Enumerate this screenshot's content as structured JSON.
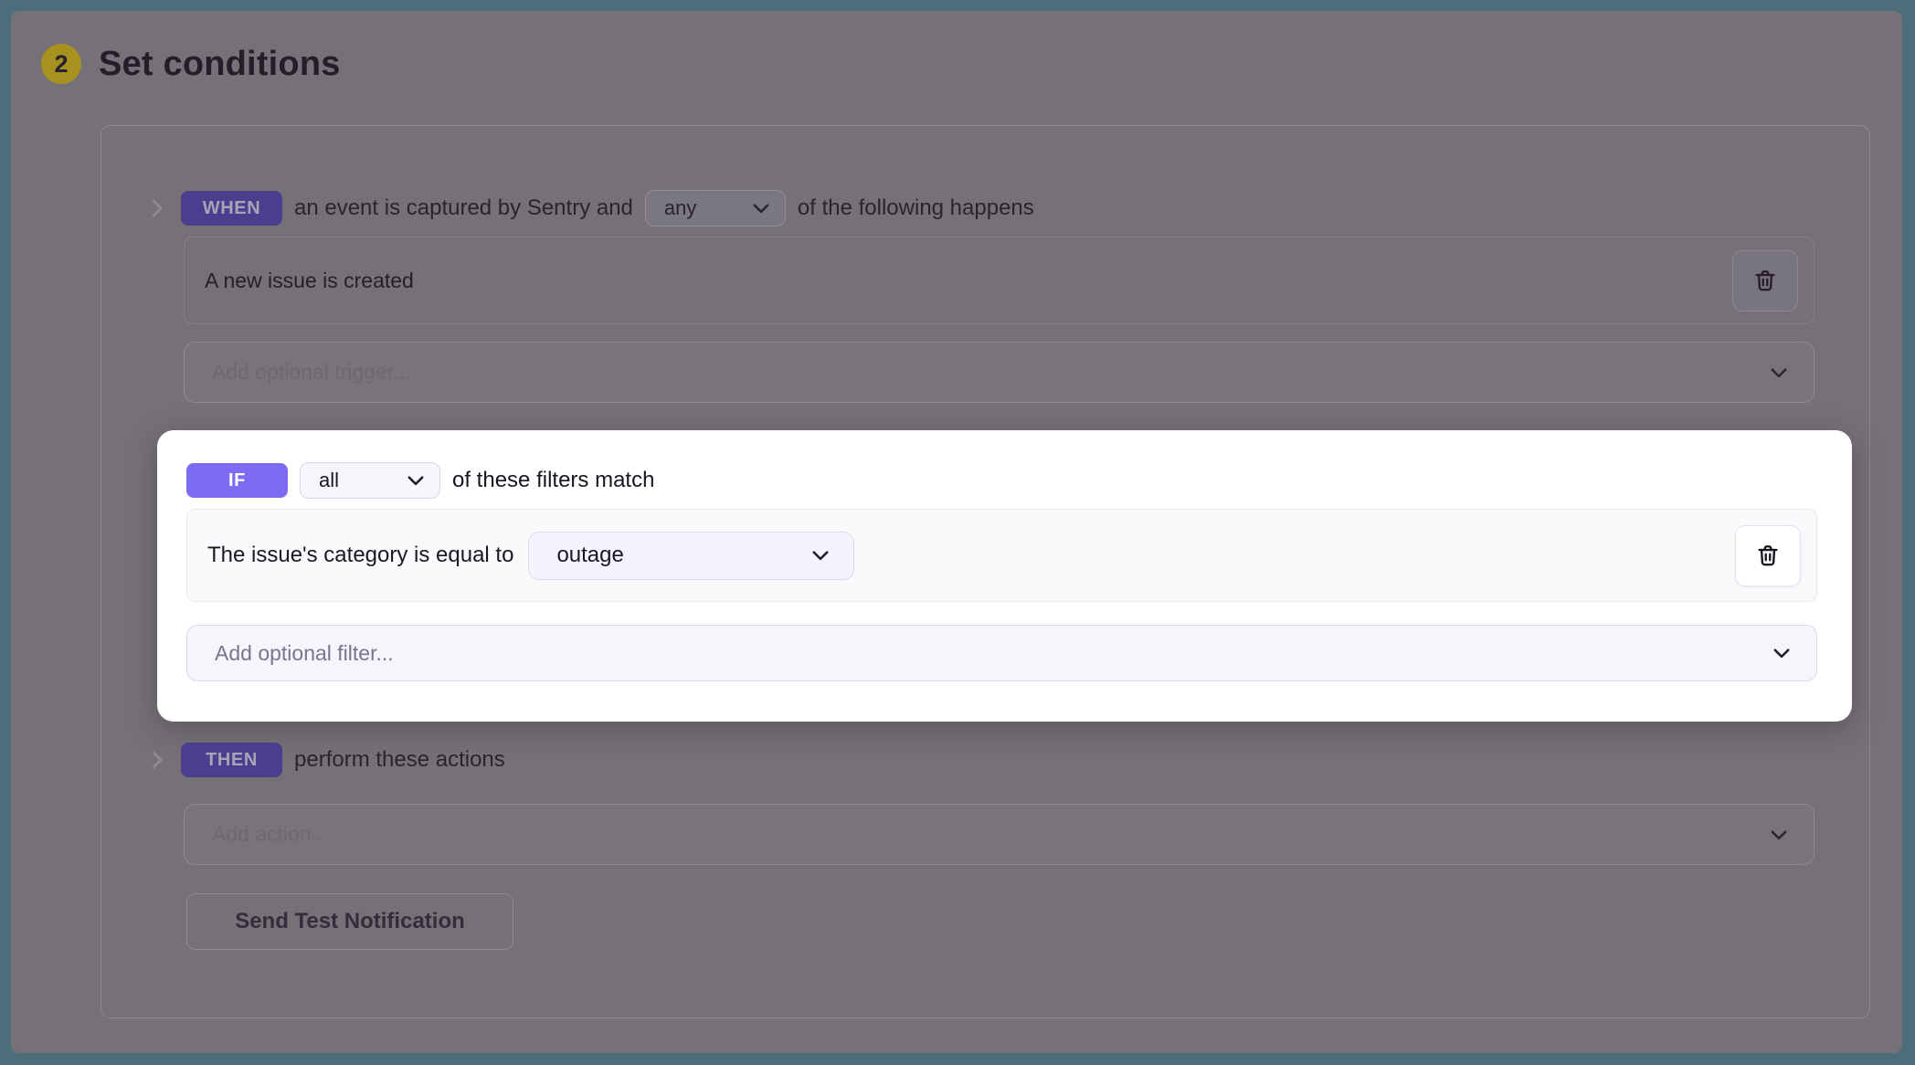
{
  "colors": {
    "frame_teal": "#4b6e7a",
    "page_dim_bg": "#767177",
    "accent_purple": "#7c6bf3",
    "dim_purple": "#4a3f8e",
    "step_badge_yellow": "#a8921f",
    "highlight_card_bg": "#ffffff"
  },
  "header": {
    "step_number": "2",
    "title": "Set conditions"
  },
  "when_section": {
    "badge_label": "WHEN",
    "text_before_select": "an event is captured by Sentry and",
    "match_select_value": "any",
    "text_after_select": "of the following happens",
    "conditions": [
      {
        "label": "A new issue is created"
      }
    ],
    "add_trigger_placeholder": "Add optional trigger..."
  },
  "if_section": {
    "badge_label": "IF",
    "match_select_value": "all",
    "text_after_select": "of these filters match",
    "filters": [
      {
        "label": "The issue's category is equal to",
        "value_select": "outage"
      }
    ],
    "add_filter_placeholder": "Add optional filter..."
  },
  "then_section": {
    "badge_label": "THEN",
    "text_after_badge": "perform these actions",
    "add_action_placeholder": "Add action..."
  },
  "footer": {
    "send_test_button_label": "Send Test Notification"
  },
  "icons": {
    "trash": "trash-icon",
    "chevron_down": "chevron-down-icon",
    "collapse": "chevron-right-icon"
  }
}
